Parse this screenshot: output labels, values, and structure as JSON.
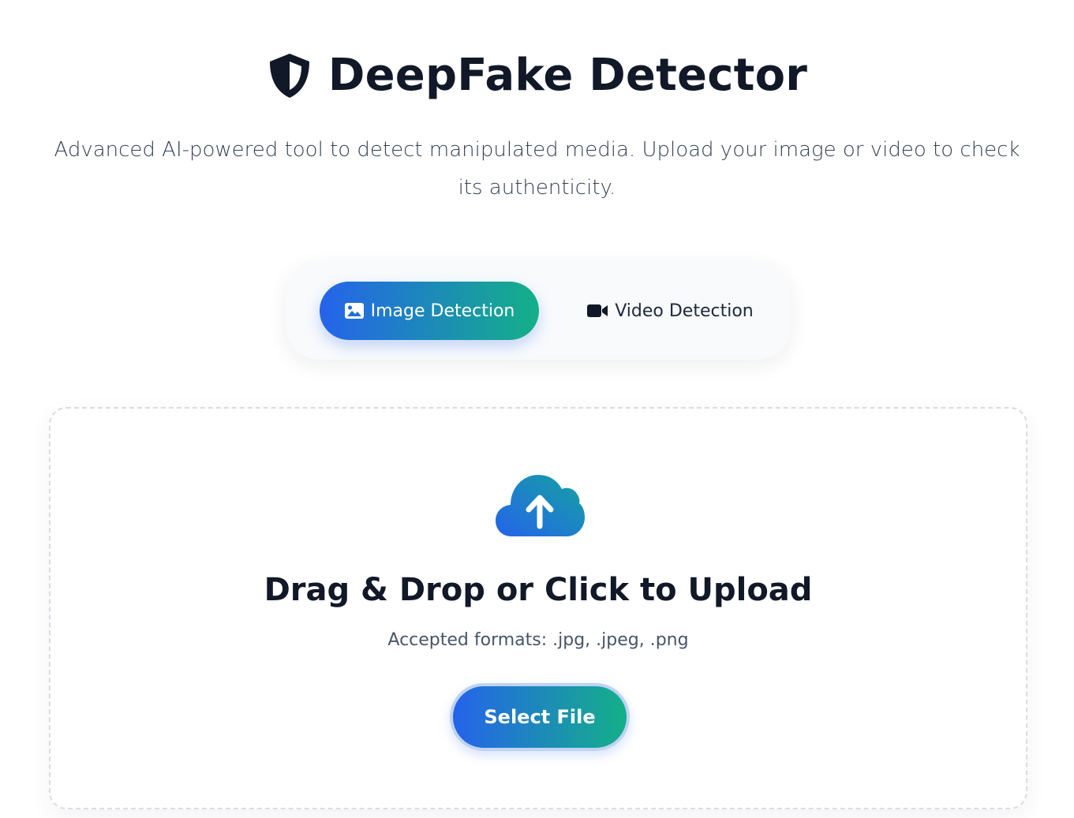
{
  "header": {
    "icon": "shield-icon",
    "title": "DeepFake Detector",
    "subtitle": "Advanced AI-powered tool to detect manipulated media. Upload your image or video to check its authenticity."
  },
  "tabs": [
    {
      "label": "Image Detection",
      "icon": "image-icon",
      "active": true
    },
    {
      "label": "Video Detection",
      "icon": "video-camera-icon",
      "active": false
    }
  ],
  "upload": {
    "icon": "cloud-upload-icon",
    "title": "Drag & Drop or Click to Upload",
    "formats": "Accepted formats: .jpg, .jpeg, .png",
    "button_label": "Select File"
  },
  "colors": {
    "gradient_start": "#2563eb",
    "gradient_end": "#14b088",
    "title_text": "#111827",
    "panel_bg": "#f8fafc"
  }
}
